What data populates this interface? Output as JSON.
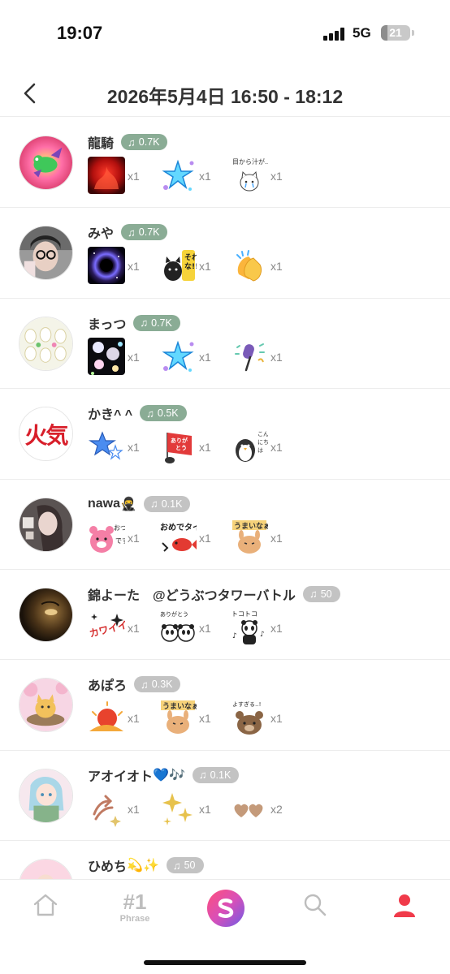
{
  "status": {
    "time": "19:07",
    "network": "5G",
    "battery": "21",
    "battery_level": 0.21
  },
  "header": {
    "title": "2026年5月4日 16:50 - 18:12"
  },
  "tabbar": {
    "phrase_top": "#1",
    "phrase_label": "Phrase"
  },
  "badge_icon": "music-note-icon",
  "users": [
    {
      "name": "龍騎",
      "badge": "0.7K",
      "badge_color": "#8aac95",
      "avatar_icon": "dragon-avatar",
      "gifts": [
        {
          "icon": "red-fire-sticker",
          "count": "x1"
        },
        {
          "icon": "blue-stars-sticker",
          "count": "x1"
        },
        {
          "icon": "crying-cat-sticker",
          "text": "目から汁が…",
          "count": "x1"
        }
      ]
    },
    {
      "name": "みや",
      "badge": "0.7K",
      "badge_color": "#8aac95",
      "avatar_icon": "photo-avatar",
      "gifts": [
        {
          "icon": "galaxy-sticker",
          "count": "x1"
        },
        {
          "icon": "black-cat-sticker",
          "text": "それな!!",
          "count": "x1"
        },
        {
          "icon": "clapping-hands-sticker",
          "count": "x1"
        }
      ]
    },
    {
      "name": "まっつ",
      "badge": "0.7K",
      "badge_color": "#8aac95",
      "avatar_icon": "eggs-avatar",
      "gifts": [
        {
          "icon": "bubbles-sticker",
          "count": "x1"
        },
        {
          "icon": "blue-stars-sticker",
          "count": "x1"
        },
        {
          "icon": "microphone-sticker",
          "count": "x1"
        }
      ]
    },
    {
      "name": "かき^ ^",
      "badge": "0.5K",
      "badge_color": "#8aac95",
      "avatar_icon": "kanji-avatar",
      "avatar_text": "火気",
      "gifts": [
        {
          "icon": "blue-star-sticker",
          "count": "x1"
        },
        {
          "icon": "thanks-flag-sticker",
          "text": "ありがとう",
          "count": "x1"
        },
        {
          "icon": "penguin-hello-sticker",
          "text": "こんにちは",
          "count": "x1"
        }
      ]
    },
    {
      "name": "nawa",
      "name_emoji": "🥷",
      "badge": "0.1K",
      "badge_color": "#c3c3c3",
      "avatar_icon": "girl-avatar",
      "gifts": [
        {
          "icon": "pink-bear-sticker",
          "text": "おつです",
          "count": "x1"
        },
        {
          "icon": "congrats-fish-sticker",
          "text": "おめでタイ",
          "count": "x1"
        },
        {
          "icon": "tasty-bunny-sticker",
          "text": "うまいなぁ",
          "count": "x1"
        }
      ]
    },
    {
      "name": "錦よーた　@どうぶつタワーバトル",
      "badge": "50",
      "badge_color": "#c3c3c3",
      "avatar_icon": "dark-photo-avatar",
      "gifts": [
        {
          "icon": "cute-text-sticker",
          "text": "カワイイ",
          "count": "x1"
        },
        {
          "icon": "panda-thanks-sticker",
          "text": "ありがとう",
          "count": "x1"
        },
        {
          "icon": "panda-dance-sticker",
          "text": "トコトコ",
          "count": "x1"
        }
      ]
    },
    {
      "name": "あぽろ",
      "badge": "0.3K",
      "badge_color": "#c3c3c3",
      "avatar_icon": "cat-avatar",
      "gifts": [
        {
          "icon": "sunrise-sticker",
          "count": "x1"
        },
        {
          "icon": "tasty-bunny-sticker",
          "text": "うまいなぁ",
          "count": "x1"
        },
        {
          "icon": "bear-sticker",
          "text": "よすぎる‥!",
          "count": "x1"
        }
      ]
    },
    {
      "name": "アオイオト",
      "name_emoji": "💙🎶",
      "badge": "0.1K",
      "badge_color": "#c3c3c3",
      "avatar_icon": "anime-girl-avatar",
      "gifts": [
        {
          "icon": "arrow-sparkle-sticker",
          "count": "x1"
        },
        {
          "icon": "sparkles-sticker",
          "count": "x1"
        },
        {
          "icon": "hearts-sticker",
          "count": "x2"
        }
      ]
    },
    {
      "name": "ひめち",
      "name_emoji": "💫✨",
      "badge": "50",
      "badge_color": "#c3c3c3",
      "avatar_icon": "pink-avatar",
      "gifts": []
    }
  ]
}
